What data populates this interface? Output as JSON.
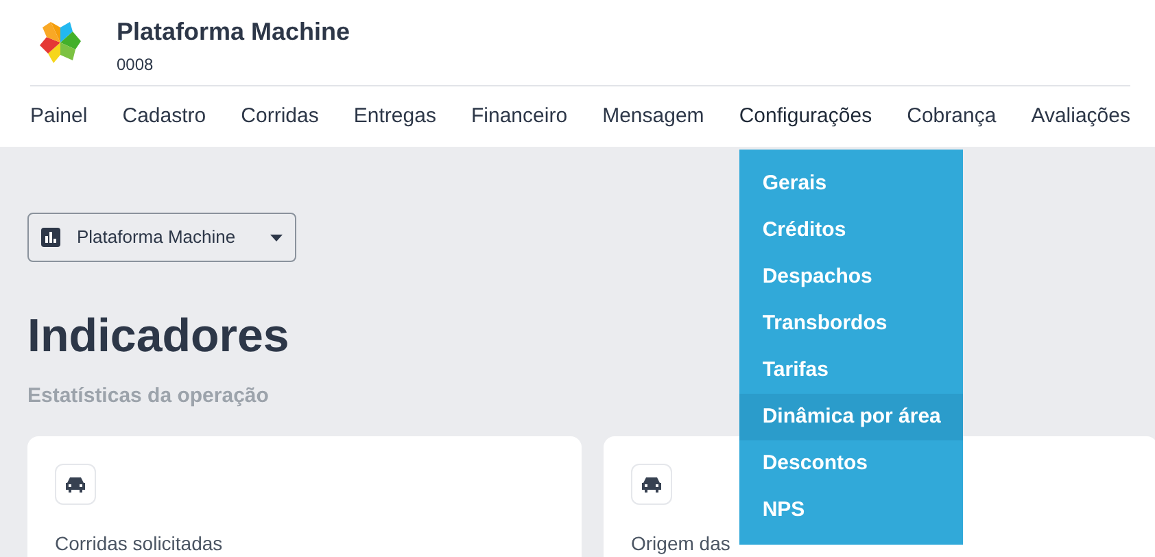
{
  "header": {
    "title": "Plataforma Machine",
    "subtitle": "0008"
  },
  "nav": [
    {
      "label": "Painel",
      "open": false
    },
    {
      "label": "Cadastro",
      "open": false
    },
    {
      "label": "Corridas",
      "open": false
    },
    {
      "label": "Entregas",
      "open": false
    },
    {
      "label": "Financeiro",
      "open": false
    },
    {
      "label": "Mensagem",
      "open": false
    },
    {
      "label": "Configurações",
      "open": true
    },
    {
      "label": "Cobrança",
      "open": false
    },
    {
      "label": "Avaliações",
      "open": false
    }
  ],
  "menu": [
    {
      "label": "Gerais",
      "selected": false
    },
    {
      "label": "Créditos",
      "selected": false
    },
    {
      "label": "Despachos",
      "selected": false
    },
    {
      "label": "Transbordos",
      "selected": false
    },
    {
      "label": "Tarifas",
      "selected": false
    },
    {
      "label": "Dinâmica por área",
      "selected": true
    },
    {
      "label": "Descontos",
      "selected": false
    },
    {
      "label": "NPS",
      "selected": false
    }
  ],
  "platform_select": {
    "value": "Plataforma Machine"
  },
  "heading": "Indicadores",
  "subheading": "Estatísticas da operação",
  "cards": [
    {
      "title": "Corridas solicitadas"
    },
    {
      "title": "Origem das"
    }
  ]
}
